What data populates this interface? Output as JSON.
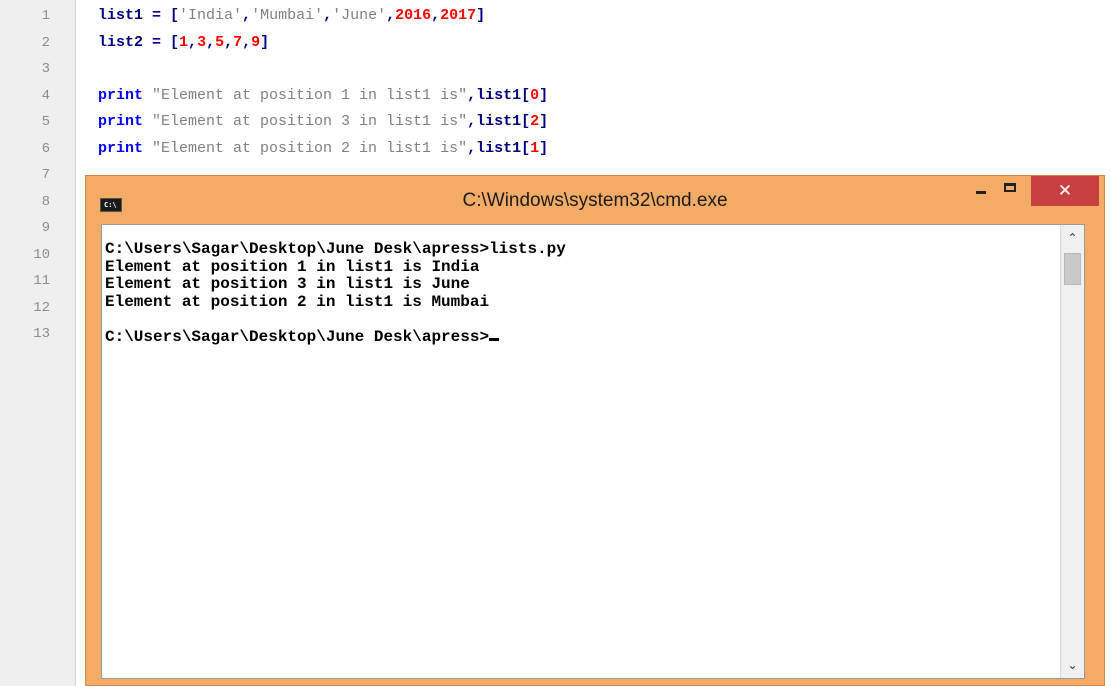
{
  "editor": {
    "line_numbers": [
      "1",
      "2",
      "3",
      "4",
      "5",
      "6",
      "7",
      "8",
      "9",
      "10",
      "11",
      "12",
      "13"
    ],
    "lines": [
      [
        {
          "t": "id",
          "v": "list1 "
        },
        {
          "t": "op",
          "v": "= ["
        },
        {
          "t": "str",
          "v": "'India'"
        },
        {
          "t": "op",
          "v": ","
        },
        {
          "t": "str",
          "v": "'Mumbai'"
        },
        {
          "t": "op",
          "v": ","
        },
        {
          "t": "str",
          "v": "'June'"
        },
        {
          "t": "op",
          "v": ","
        },
        {
          "t": "num",
          "v": "2016"
        },
        {
          "t": "op",
          "v": ","
        },
        {
          "t": "num",
          "v": "2017"
        },
        {
          "t": "op",
          "v": "]"
        }
      ],
      [
        {
          "t": "id",
          "v": "list2 "
        },
        {
          "t": "op",
          "v": "= ["
        },
        {
          "t": "num",
          "v": "1"
        },
        {
          "t": "op",
          "v": ","
        },
        {
          "t": "num",
          "v": "3"
        },
        {
          "t": "op",
          "v": ","
        },
        {
          "t": "num",
          "v": "5"
        },
        {
          "t": "op",
          "v": ","
        },
        {
          "t": "num",
          "v": "7"
        },
        {
          "t": "op",
          "v": ","
        },
        {
          "t": "num",
          "v": "9"
        },
        {
          "t": "op",
          "v": "]"
        }
      ],
      [],
      [
        {
          "t": "kw",
          "v": "print "
        },
        {
          "t": "str",
          "v": "\"Element at position 1 in list1 is\""
        },
        {
          "t": "op",
          "v": ","
        },
        {
          "t": "id",
          "v": "list1"
        },
        {
          "t": "op",
          "v": "["
        },
        {
          "t": "num",
          "v": "0"
        },
        {
          "t": "op",
          "v": "]"
        }
      ],
      [
        {
          "t": "kw",
          "v": "print "
        },
        {
          "t": "str",
          "v": "\"Element at position 3 in list1 is\""
        },
        {
          "t": "op",
          "v": ","
        },
        {
          "t": "id",
          "v": "list1"
        },
        {
          "t": "op",
          "v": "["
        },
        {
          "t": "num",
          "v": "2"
        },
        {
          "t": "op",
          "v": "]"
        }
      ],
      [
        {
          "t": "kw",
          "v": "print "
        },
        {
          "t": "str",
          "v": "\"Element at position 2 in list1 is\""
        },
        {
          "t": "op",
          "v": ","
        },
        {
          "t": "id",
          "v": "list1"
        },
        {
          "t": "op",
          "v": "["
        },
        {
          "t": "num",
          "v": "1"
        },
        {
          "t": "op",
          "v": "]"
        }
      ]
    ]
  },
  "cmd": {
    "title": "C:\\Windows\\system32\\cmd.exe",
    "app_icon": "cmd-icon",
    "app_icon_text": "C:\\",
    "minimize_icon": "minimize-icon",
    "maximize_icon": "maximize-icon",
    "close_label": "✕",
    "scroll_up": "⌃",
    "scroll_down": "⌄",
    "output_lines": [
      "C:\\Users\\Sagar\\Desktop\\June Desk\\apress>lists.py",
      "Element at position 1 in list1 is India",
      "Element at position 3 in list1 is June",
      "Element at position 2 in list1 is Mumbai",
      "",
      "C:\\Users\\Sagar\\Desktop\\June Desk\\apress>"
    ]
  }
}
